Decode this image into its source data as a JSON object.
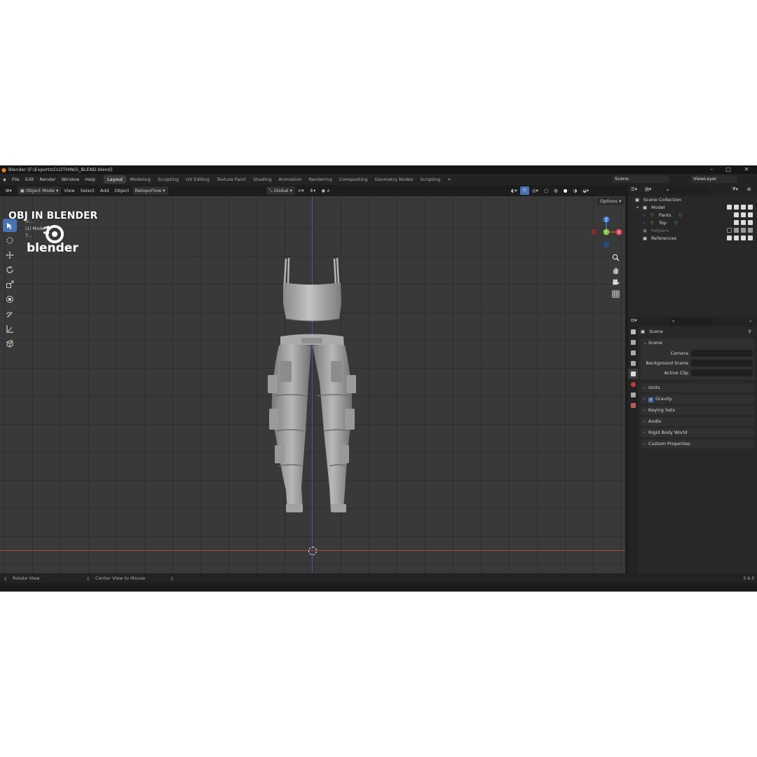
{
  "watermark": {
    "title": "OBJ IN BLENDER",
    "logo_text": "blender"
  },
  "window": {
    "title": "Blender [F:\\Exports\\CLOTHING\\_BLEND.blend]",
    "controls": [
      "–",
      "□",
      "✕"
    ]
  },
  "menus": [
    "File",
    "Edit",
    "Render",
    "Window",
    "Help"
  ],
  "workspaces": [
    "Layout",
    "Modeling",
    "Sculpting",
    "UV Editing",
    "Texture Paint",
    "Shading",
    "Animation",
    "Rendering",
    "Compositing",
    "Geometry Nodes",
    "Scripting"
  ],
  "active_workspace": "Layout",
  "add_workspace": "+",
  "scene_field": "Scene",
  "viewlayer_field": "ViewLayer",
  "viewport_header": {
    "mode": "Object Mode",
    "menus": [
      "View",
      "Select",
      "Add",
      "Object",
      "RetopoFlow"
    ],
    "transform_orientation": "Global",
    "options": "Options"
  },
  "viewport_overlay": {
    "line1": "Fr…",
    "line2": "(1) Model",
    "line3": "7…"
  },
  "gizmo": {
    "x": "X",
    "y": "Y",
    "z": "Z"
  },
  "outliner": {
    "root": "Scene Collection",
    "items": [
      {
        "label": "Model",
        "depth": 1
      },
      {
        "label": "Pants",
        "depth": 2
      },
      {
        "label": "Top",
        "depth": 2
      },
      {
        "label": "Helpers",
        "depth": 1,
        "disabled": true
      },
      {
        "label": "References",
        "depth": 1
      }
    ]
  },
  "properties": {
    "context": "Scene",
    "section": "Scene",
    "rows": [
      {
        "label": "Camera"
      },
      {
        "label": "Background Scene"
      },
      {
        "label": "Active Clip"
      }
    ],
    "panels": [
      {
        "label": "Units"
      },
      {
        "label": "Gravity",
        "checkbox": true
      },
      {
        "label": "Keying Sets"
      },
      {
        "label": "Audio"
      },
      {
        "label": "Rigid Body World"
      },
      {
        "label": "Custom Properties"
      }
    ]
  },
  "statusbar": {
    "left": "Rotate View",
    "middle": "Center View to Mouse",
    "version": "3.6.0"
  },
  "colors": {
    "accent": "#4772b3",
    "x_axis": "#a94a4a",
    "y_axis": "#4a5fa8",
    "gizmo_x": "#e0424a",
    "gizmo_y": "#7ec43a",
    "gizmo_z": "#3c7ad6",
    "mesh_icon": "#e89642",
    "mesh_data_icon": "#4fc58a"
  }
}
